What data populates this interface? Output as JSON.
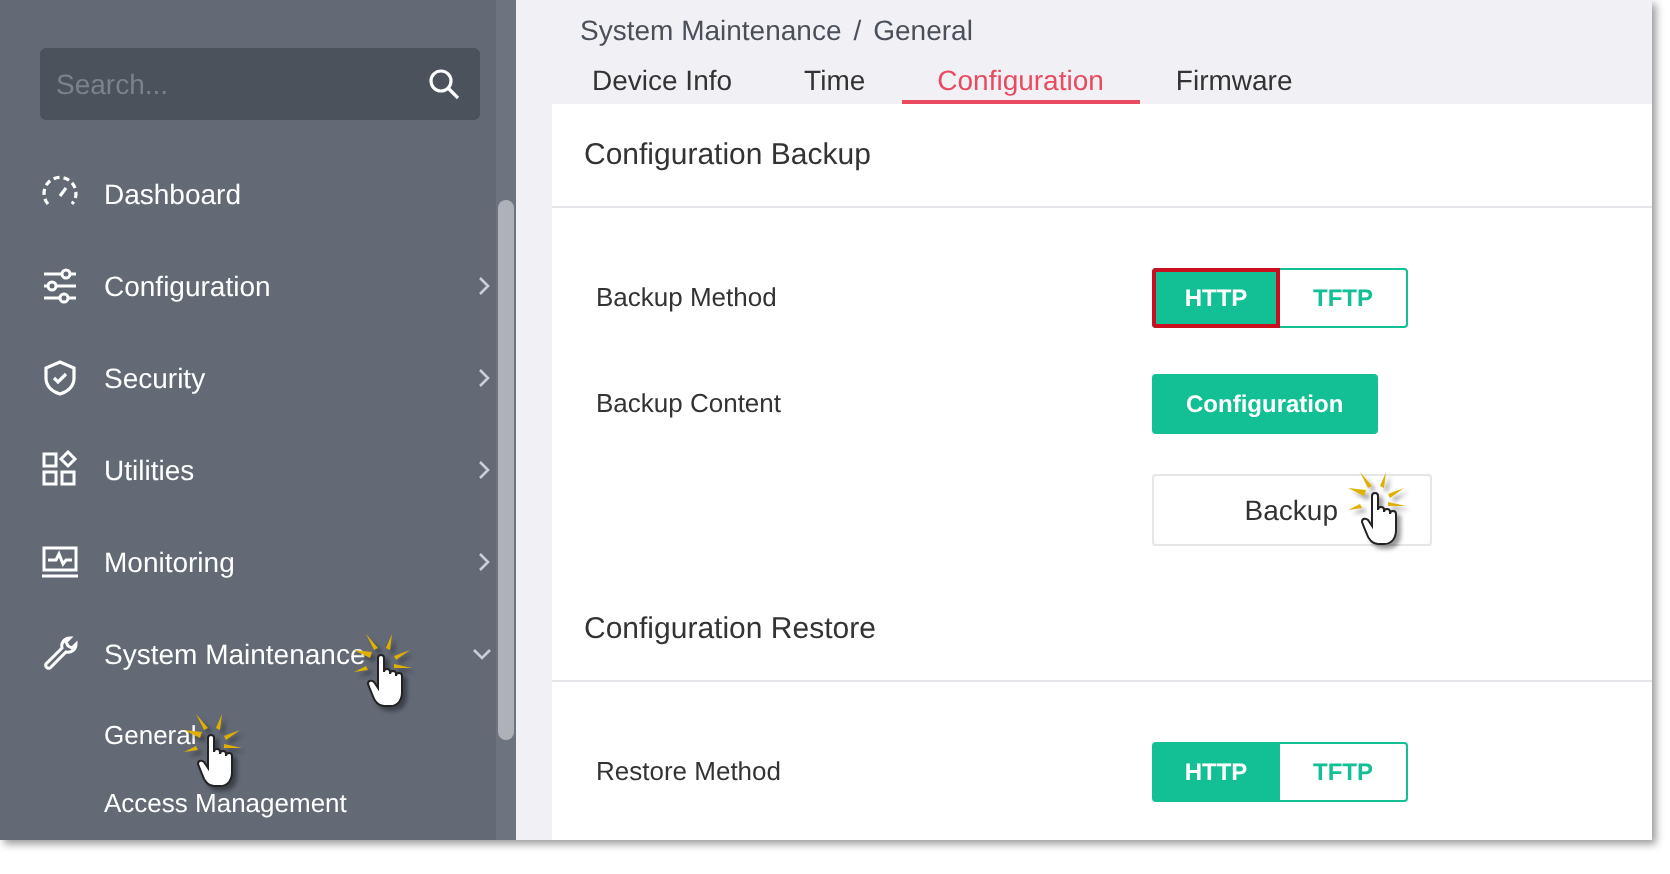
{
  "sidebar": {
    "search": {
      "placeholder": "Search..."
    },
    "items": [
      {
        "label": "Dashboard",
        "expandable": false,
        "expanded": false,
        "clicked": false
      },
      {
        "label": "Configuration",
        "expandable": true,
        "expanded": false,
        "clicked": false
      },
      {
        "label": "Security",
        "expandable": true,
        "expanded": false,
        "clicked": false
      },
      {
        "label": "Utilities",
        "expandable": true,
        "expanded": false,
        "clicked": false
      },
      {
        "label": "Monitoring",
        "expandable": true,
        "expanded": false,
        "clicked": false
      },
      {
        "label": "System Maintenance",
        "expandable": true,
        "expanded": true,
        "clicked": true,
        "children": [
          {
            "label": "General",
            "clicked": true
          },
          {
            "label": "Access Management",
            "clicked": false
          }
        ]
      }
    ]
  },
  "breadcrumb": {
    "items": [
      "System Maintenance",
      "General"
    ],
    "separator": "/"
  },
  "tabs": [
    {
      "label": "Device Info",
      "selected": false
    },
    {
      "label": "Time",
      "selected": false
    },
    {
      "label": "Configuration",
      "selected": true
    },
    {
      "label": "Firmware",
      "selected": false
    }
  ],
  "sections": [
    {
      "title": "Configuration Backup",
      "rows": [
        {
          "kind": "segmented",
          "label": "Backup Method",
          "options": [
            {
              "label": "HTTP",
              "selected": true,
              "highlighted": true
            },
            {
              "label": "TFTP",
              "selected": false,
              "highlighted": false
            }
          ]
        },
        {
          "kind": "tag",
          "label": "Backup Content",
          "options": [
            {
              "label": "Configuration",
              "selected": true
            }
          ]
        },
        {
          "kind": "action",
          "button": {
            "label": "Backup",
            "clicked": true
          }
        }
      ]
    },
    {
      "title": "Configuration Restore",
      "rows": [
        {
          "kind": "segmented",
          "label": "Restore Method",
          "options": [
            {
              "label": "HTTP",
              "selected": true,
              "highlighted": false
            },
            {
              "label": "TFTP",
              "selected": false,
              "highlighted": false
            }
          ]
        }
      ]
    }
  ]
}
